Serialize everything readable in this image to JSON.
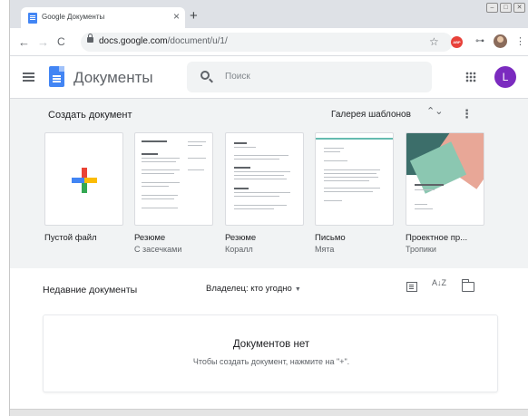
{
  "browser": {
    "tab_title": "Google Документы",
    "tab_close": "×",
    "new_tab": "+",
    "window_controls": [
      "–",
      "□",
      "✕"
    ],
    "back": "←",
    "forward": "→",
    "reload": "C",
    "url_host": "docs.google.com",
    "url_path": "/document/u/1/",
    "bookmark": "☆",
    "adblock_label": "ABP",
    "key_ext": "⊶",
    "menu": "⋮"
  },
  "header": {
    "app_name": "Документы",
    "search_placeholder": "Поиск",
    "avatar_letter": "L",
    "avatar_color": "#7b2bbf"
  },
  "gallery": {
    "title": "Создать документ",
    "link": "Галерея шаблонов",
    "expand_arrows": "⌃⌄",
    "more": "⋮",
    "templates": [
      {
        "name": "Пустой файл",
        "sub": ""
      },
      {
        "name": "Резюме",
        "sub": "С засечками"
      },
      {
        "name": "Резюме",
        "sub": "Коралл"
      },
      {
        "name": "Письмо",
        "sub": "Мята"
      },
      {
        "name": "Проектное пр...",
        "sub": "Тропики"
      }
    ]
  },
  "recent": {
    "title": "Недавние документы",
    "owner_filter": "Владелец: кто угодно",
    "owner_caret": "▼",
    "sort_label": "A↓Z",
    "empty_title": "Документов нет",
    "empty_subtitle": "Чтобы создать документ, нажмите на \"+\"."
  }
}
